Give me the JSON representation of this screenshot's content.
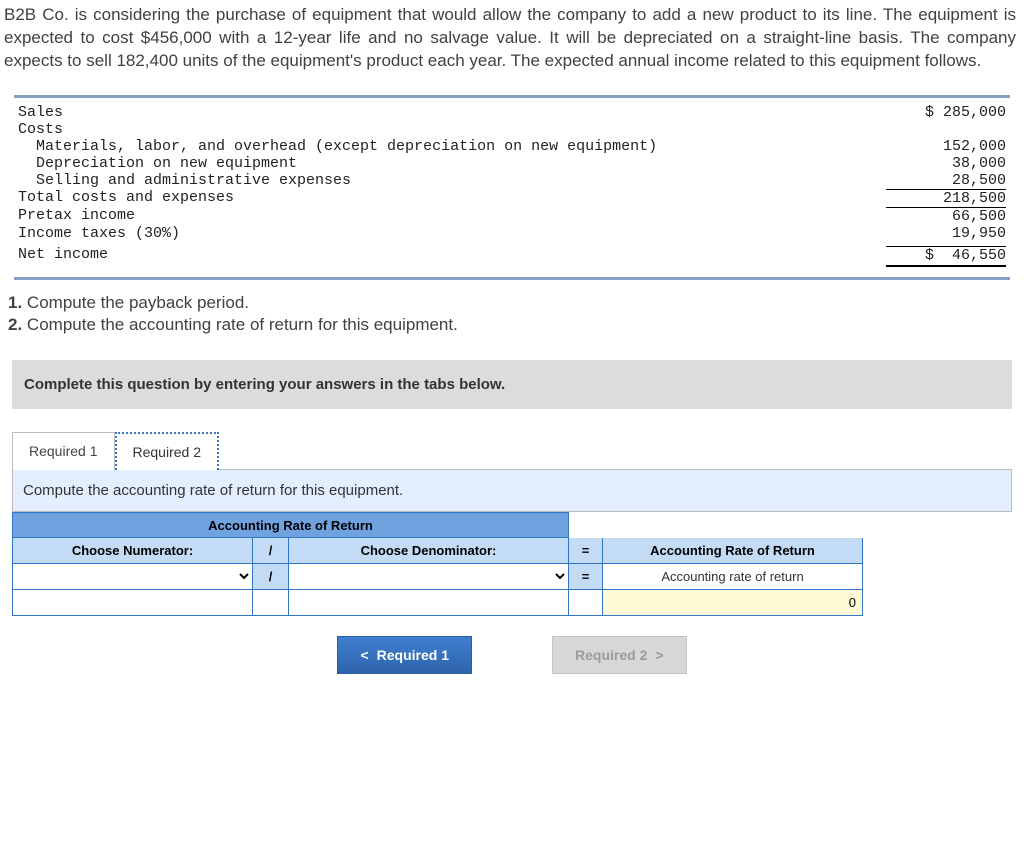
{
  "problem": "B2B Co. is considering the purchase of equipment that would allow the company to add a new product to its line. The equipment is expected to cost $456,000 with a 12-year life and no salvage value. It will be depreciated on a straight-line basis. The company expects to sell 182,400 units of the equipment's product each year. The expected annual income related to this equipment follows.",
  "income": {
    "sales_label": "Sales",
    "sales_value": "$ 285,000",
    "costs_label": "Costs",
    "mlo_label": "Materials, labor, and overhead (except depreciation on new equipment)",
    "mlo_value": "152,000",
    "dep_label": "Depreciation on new equipment",
    "dep_value": "38,000",
    "sa_label": "Selling and administrative expenses",
    "sa_value": "28,500",
    "total_label": "Total costs and expenses",
    "total_value": "218,500",
    "pretax_label": "Pretax income",
    "pretax_value": "66,500",
    "tax_label": "Income taxes (30%)",
    "tax_value": "19,950",
    "net_label": "Net income",
    "net_value": "$  46,550"
  },
  "questions": {
    "q1_num": "1.",
    "q1": "Compute the payback period.",
    "q2_num": "2.",
    "q2": "Compute the accounting rate of return for this equipment."
  },
  "instruction": "Complete this question by entering your answers in the tabs below.",
  "tabs": {
    "t1": "Required 1",
    "t2": "Required 2"
  },
  "sub_prompt": "Compute the accounting rate of return for this equipment.",
  "table": {
    "title": "Accounting Rate of Return",
    "num_hdr": "Choose Numerator:",
    "slash": "/",
    "den_hdr": "Choose Denominator:",
    "eq": "=",
    "res_hdr": "Accounting Rate of Return",
    "res_label": "Accounting rate of return",
    "res_value": "0"
  },
  "nav": {
    "prev_icon": "<",
    "prev": "Required 1",
    "next": "Required 2",
    "next_icon": ">"
  }
}
